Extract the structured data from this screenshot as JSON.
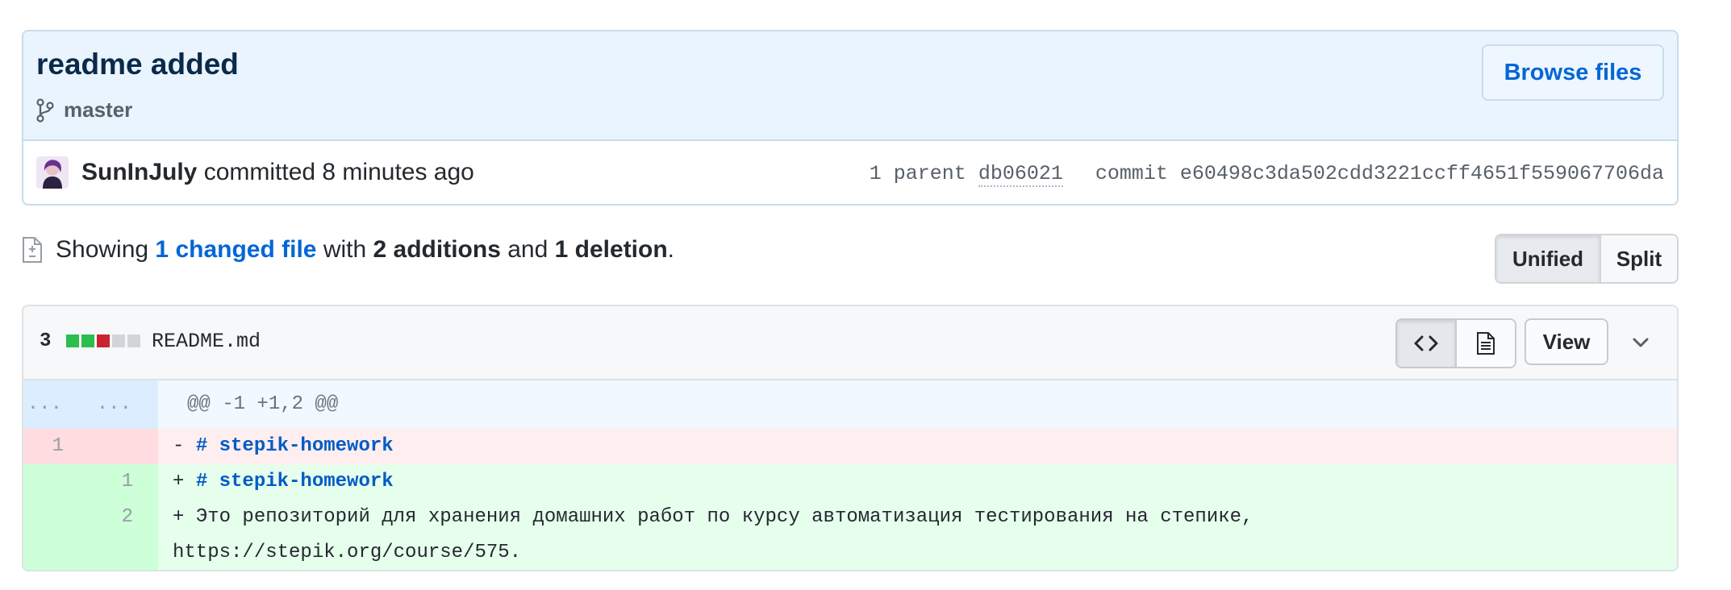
{
  "commit": {
    "title": "readme added",
    "branch": "master",
    "browse_label": "Browse files",
    "author": "SunInJuly",
    "committed_text": "committed 8 minutes ago",
    "parent_label": "1 parent",
    "parent_sha": "db06021",
    "commit_label": "commit",
    "commit_sha": "e60498c3da502cdd3221ccff4651f559067706da"
  },
  "summary": {
    "showing": "Showing",
    "changed_files": "1 changed file",
    "with": "with",
    "additions": "2 additions",
    "and": "and",
    "deletions": "1 deletion",
    "period": "."
  },
  "view_toggle": {
    "unified": "Unified",
    "split": "Split",
    "active": "unified"
  },
  "file": {
    "changes": "3",
    "diffstat": [
      "added",
      "added",
      "deleted",
      "neutral",
      "neutral"
    ],
    "name": "README.md",
    "view_label": "View",
    "colors": {
      "added": "#2cbe4e",
      "deleted": "#cb2431",
      "neutral": "#d1d5da"
    }
  },
  "diff": {
    "hunk": {
      "old_marker": "...",
      "new_marker": "...",
      "header": "@@ -1 +1,2 @@"
    },
    "lines": [
      {
        "type": "del",
        "old": "1",
        "new": "",
        "sign": "- ",
        "heading": "# stepik-homework",
        "text": ""
      },
      {
        "type": "add",
        "old": "",
        "new": "1",
        "sign": "+ ",
        "heading": "# stepik-homework",
        "text": ""
      },
      {
        "type": "add",
        "old": "",
        "new": "2",
        "sign": "+ ",
        "heading": "",
        "text": "Это репозиторий для хранения домашних работ по курсу автоматизация тестирования на степике, https://stepik.org/course/575."
      }
    ]
  }
}
